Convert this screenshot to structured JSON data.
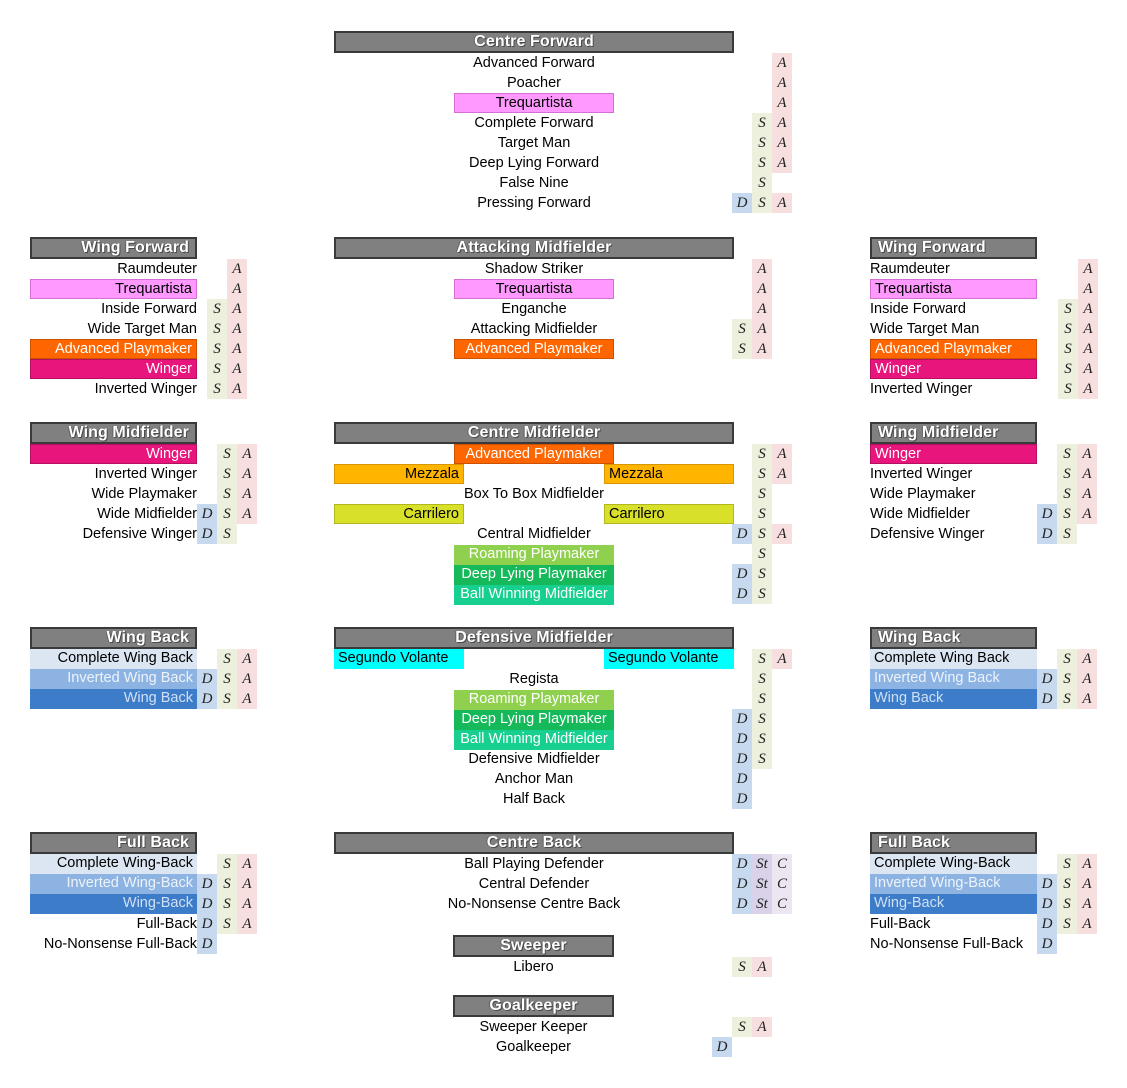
{
  "palette": {
    "header_bg": "#808080",
    "header_border": "#3a3a3a",
    "trequartista": "#ff99ff",
    "advanced_playmaker": "#ff6600",
    "winger": "#e8157c",
    "mezzala": "#ffb400",
    "carrilero": "#d8e02a",
    "roaming_playmaker": "#8fd14f",
    "deep_lying_playmaker": "#16b95a",
    "ball_winning_midfielder": "#17cf8f",
    "segundo_volante": "#00ffff",
    "complete_wing_back": "#dce6f2",
    "inverted_wing_back": "#8db3e2",
    "wing_back": "#3d7cc9",
    "duty_d": "#c6d9ef",
    "duty_s": "#ecf0dd",
    "duty_a": "#f7dfdf",
    "duty_st": "#d9d2e9",
    "duty_c": "#ece5f2"
  },
  "duty_labels": {
    "d": "D",
    "s": "S",
    "a": "A",
    "st": "St",
    "c": "C"
  },
  "groups": {
    "centre_forward": {
      "title": "Centre Forward",
      "roles": [
        {
          "label": "Advanced Forward",
          "duties": [
            "",
            "",
            "A"
          ]
        },
        {
          "label": "Poacher",
          "duties": [
            "",
            "",
            "A"
          ]
        },
        {
          "label": "Trequartista",
          "duties": [
            "",
            "",
            "A"
          ]
        },
        {
          "label": "Complete Forward",
          "duties": [
            "",
            "S",
            "A"
          ]
        },
        {
          "label": "Target Man",
          "duties": [
            "",
            "S",
            "A"
          ]
        },
        {
          "label": "Deep Lying Forward",
          "duties": [
            "",
            "S",
            "A"
          ]
        },
        {
          "label": "False Nine",
          "duties": [
            "",
            "S",
            ""
          ]
        },
        {
          "label": "Pressing Forward",
          "duties": [
            "D",
            "S",
            "A"
          ]
        }
      ]
    },
    "wing_forward_left": {
      "title": "Wing Forward",
      "roles": [
        {
          "label": "Raumdeuter",
          "duties": [
            "",
            "A"
          ]
        },
        {
          "label": "Trequartista",
          "duties": [
            "",
            "A"
          ]
        },
        {
          "label": "Inside Forward",
          "duties": [
            "S",
            "A"
          ]
        },
        {
          "label": "Wide Target Man",
          "duties": [
            "S",
            "A"
          ]
        },
        {
          "label": "Advanced Playmaker",
          "duties": [
            "S",
            "A"
          ]
        },
        {
          "label": "Winger",
          "duties": [
            "S",
            "A"
          ]
        },
        {
          "label": "Inverted Winger",
          "duties": [
            "S",
            "A"
          ]
        }
      ]
    },
    "wing_forward_right": {
      "title": "Wing Forward",
      "roles": [
        {
          "label": "Raumdeuter",
          "duties": [
            "",
            "A"
          ]
        },
        {
          "label": "Trequartista",
          "duties": [
            "",
            "A"
          ]
        },
        {
          "label": "Inside Forward",
          "duties": [
            "S",
            "A"
          ]
        },
        {
          "label": "Wide Target Man",
          "duties": [
            "S",
            "A"
          ]
        },
        {
          "label": "Advanced Playmaker",
          "duties": [
            "S",
            "A"
          ]
        },
        {
          "label": "Winger",
          "duties": [
            "S",
            "A"
          ]
        },
        {
          "label": "Inverted Winger",
          "duties": [
            "S",
            "A"
          ]
        }
      ]
    },
    "attacking_midfielder": {
      "title": "Attacking Midfielder",
      "roles": [
        {
          "label": "Shadow Striker",
          "duties": [
            "",
            "",
            "A"
          ]
        },
        {
          "label": "Trequartista",
          "duties": [
            "",
            "",
            "A"
          ]
        },
        {
          "label": "Enganche",
          "duties": [
            "",
            "",
            "A"
          ]
        },
        {
          "label": "Attacking Midfielder",
          "duties": [
            "",
            "S",
            "A"
          ]
        },
        {
          "label": "Advanced Playmaker",
          "duties": [
            "",
            "S",
            "A"
          ]
        }
      ]
    },
    "wing_midfielder_left": {
      "title": "Wing Midfielder",
      "roles": [
        {
          "label": "Winger",
          "duties": [
            "",
            "S",
            "A"
          ]
        },
        {
          "label": "Inverted Winger",
          "duties": [
            "",
            "S",
            "A"
          ]
        },
        {
          "label": "Wide Playmaker",
          "duties": [
            "",
            "S",
            "A"
          ]
        },
        {
          "label": "Wide Midfielder",
          "duties": [
            "D",
            "S",
            "A"
          ]
        },
        {
          "label": "Defensive Winger",
          "duties": [
            "D",
            "S",
            ""
          ]
        }
      ]
    },
    "wing_midfielder_right": {
      "title": "Wing Midfielder",
      "roles": [
        {
          "label": "Winger",
          "duties": [
            "",
            "S",
            "A"
          ]
        },
        {
          "label": "Inverted Winger",
          "duties": [
            "",
            "S",
            "A"
          ]
        },
        {
          "label": "Wide Playmaker",
          "duties": [
            "",
            "S",
            "A"
          ]
        },
        {
          "label": "Wide Midfielder",
          "duties": [
            "D",
            "S",
            "A"
          ]
        },
        {
          "label": "Defensive Winger",
          "duties": [
            "D",
            "S",
            ""
          ]
        }
      ]
    },
    "centre_midfielder": {
      "title": "Centre Midfielder",
      "roles": [
        {
          "label": "Advanced Playmaker",
          "duties": [
            "",
            "S",
            "A"
          ]
        },
        {
          "label": "",
          "side_left": "Mezzala",
          "side_right": "Mezzala",
          "duties": [
            "",
            "S",
            "A"
          ]
        },
        {
          "label": "Box To Box Midfielder",
          "duties": [
            "",
            "S",
            ""
          ]
        },
        {
          "label": "",
          "side_left": "Carrilero",
          "side_right": "Carrilero",
          "duties": [
            "",
            "S",
            ""
          ]
        },
        {
          "label": "Central Midfielder",
          "duties": [
            "D",
            "S",
            "A"
          ]
        },
        {
          "label": "Roaming Playmaker",
          "duties": [
            "",
            "S",
            ""
          ]
        },
        {
          "label": "Deep Lying Playmaker",
          "duties": [
            "D",
            "S",
            ""
          ]
        },
        {
          "label": "Ball Winning Midfielder",
          "duties": [
            "D",
            "S",
            ""
          ]
        }
      ]
    },
    "defensive_midfielder": {
      "title": "Defensive Midfielder",
      "roles": [
        {
          "label": "",
          "side_left": "Segundo Volante",
          "side_right": "Segundo Volante",
          "duties": [
            "",
            "S",
            "A"
          ]
        },
        {
          "label": "Regista",
          "duties": [
            "",
            "S",
            ""
          ]
        },
        {
          "label": "Roaming Playmaker",
          "duties": [
            "",
            "S",
            ""
          ]
        },
        {
          "label": "Deep Lying Playmaker",
          "duties": [
            "D",
            "S",
            ""
          ]
        },
        {
          "label": "Ball Winning Midfielder",
          "duties": [
            "D",
            "S",
            ""
          ]
        },
        {
          "label": "Defensive Midfielder",
          "duties": [
            "D",
            "S",
            ""
          ]
        },
        {
          "label": "Anchor Man",
          "duties": [
            "D",
            "",
            ""
          ]
        },
        {
          "label": "Half Back",
          "duties": [
            "D",
            "",
            ""
          ]
        }
      ]
    },
    "wing_back_left": {
      "title": "Wing Back",
      "roles": [
        {
          "label": "Complete Wing Back",
          "duties": [
            "",
            "S",
            "A"
          ]
        },
        {
          "label": "Inverted Wing Back",
          "duties": [
            "D",
            "S",
            "A"
          ]
        },
        {
          "label": "Wing Back",
          "duties": [
            "D",
            "S",
            "A"
          ]
        }
      ]
    },
    "wing_back_right": {
      "title": "Wing Back",
      "roles": [
        {
          "label": "Complete Wing Back",
          "duties": [
            "",
            "S",
            "A"
          ]
        },
        {
          "label": "Inverted Wing Back",
          "duties": [
            "D",
            "S",
            "A"
          ]
        },
        {
          "label": "Wing Back",
          "duties": [
            "D",
            "S",
            "A"
          ]
        }
      ]
    },
    "full_back_left": {
      "title": "Full Back",
      "roles": [
        {
          "label": "Complete Wing-Back",
          "duties": [
            "",
            "S",
            "A"
          ]
        },
        {
          "label": "Inverted Wing-Back",
          "duties": [
            "D",
            "S",
            "A"
          ]
        },
        {
          "label": "Wing-Back",
          "duties": [
            "D",
            "S",
            "A"
          ]
        },
        {
          "label": "Full-Back",
          "duties": [
            "D",
            "S",
            "A"
          ]
        },
        {
          "label": "No-Nonsense Full-Back",
          "duties": [
            "D",
            "",
            ""
          ]
        }
      ]
    },
    "full_back_right": {
      "title": "Full Back",
      "roles": [
        {
          "label": "Complete Wing-Back",
          "duties": [
            "",
            "S",
            "A"
          ]
        },
        {
          "label": "Inverted Wing-Back",
          "duties": [
            "D",
            "S",
            "A"
          ]
        },
        {
          "label": "Wing-Back",
          "duties": [
            "D",
            "S",
            "A"
          ]
        },
        {
          "label": "Full-Back",
          "duties": [
            "D",
            "S",
            "A"
          ]
        },
        {
          "label": "No-Nonsense Full-Back",
          "duties": [
            "D",
            "",
            ""
          ]
        }
      ]
    },
    "centre_back": {
      "title": "Centre Back",
      "roles": [
        {
          "label": "Ball Playing Defender",
          "duties": [
            "D",
            "St",
            "C"
          ]
        },
        {
          "label": "Central Defender",
          "duties": [
            "D",
            "St",
            "C"
          ]
        },
        {
          "label": "No-Nonsense Centre Back",
          "duties": [
            "D",
            "St",
            "C"
          ]
        }
      ]
    },
    "sweeper": {
      "title": "Sweeper",
      "roles": [
        {
          "label": "Libero",
          "duties": [
            "",
            "S",
            "A"
          ]
        }
      ]
    },
    "goalkeeper": {
      "title": "Goalkeeper",
      "roles": [
        {
          "label": "Sweeper Keeper",
          "duties": [
            "",
            "S",
            "A"
          ]
        },
        {
          "label": "Goalkeeper",
          "duties": [
            "D",
            "",
            ""
          ]
        }
      ]
    }
  }
}
